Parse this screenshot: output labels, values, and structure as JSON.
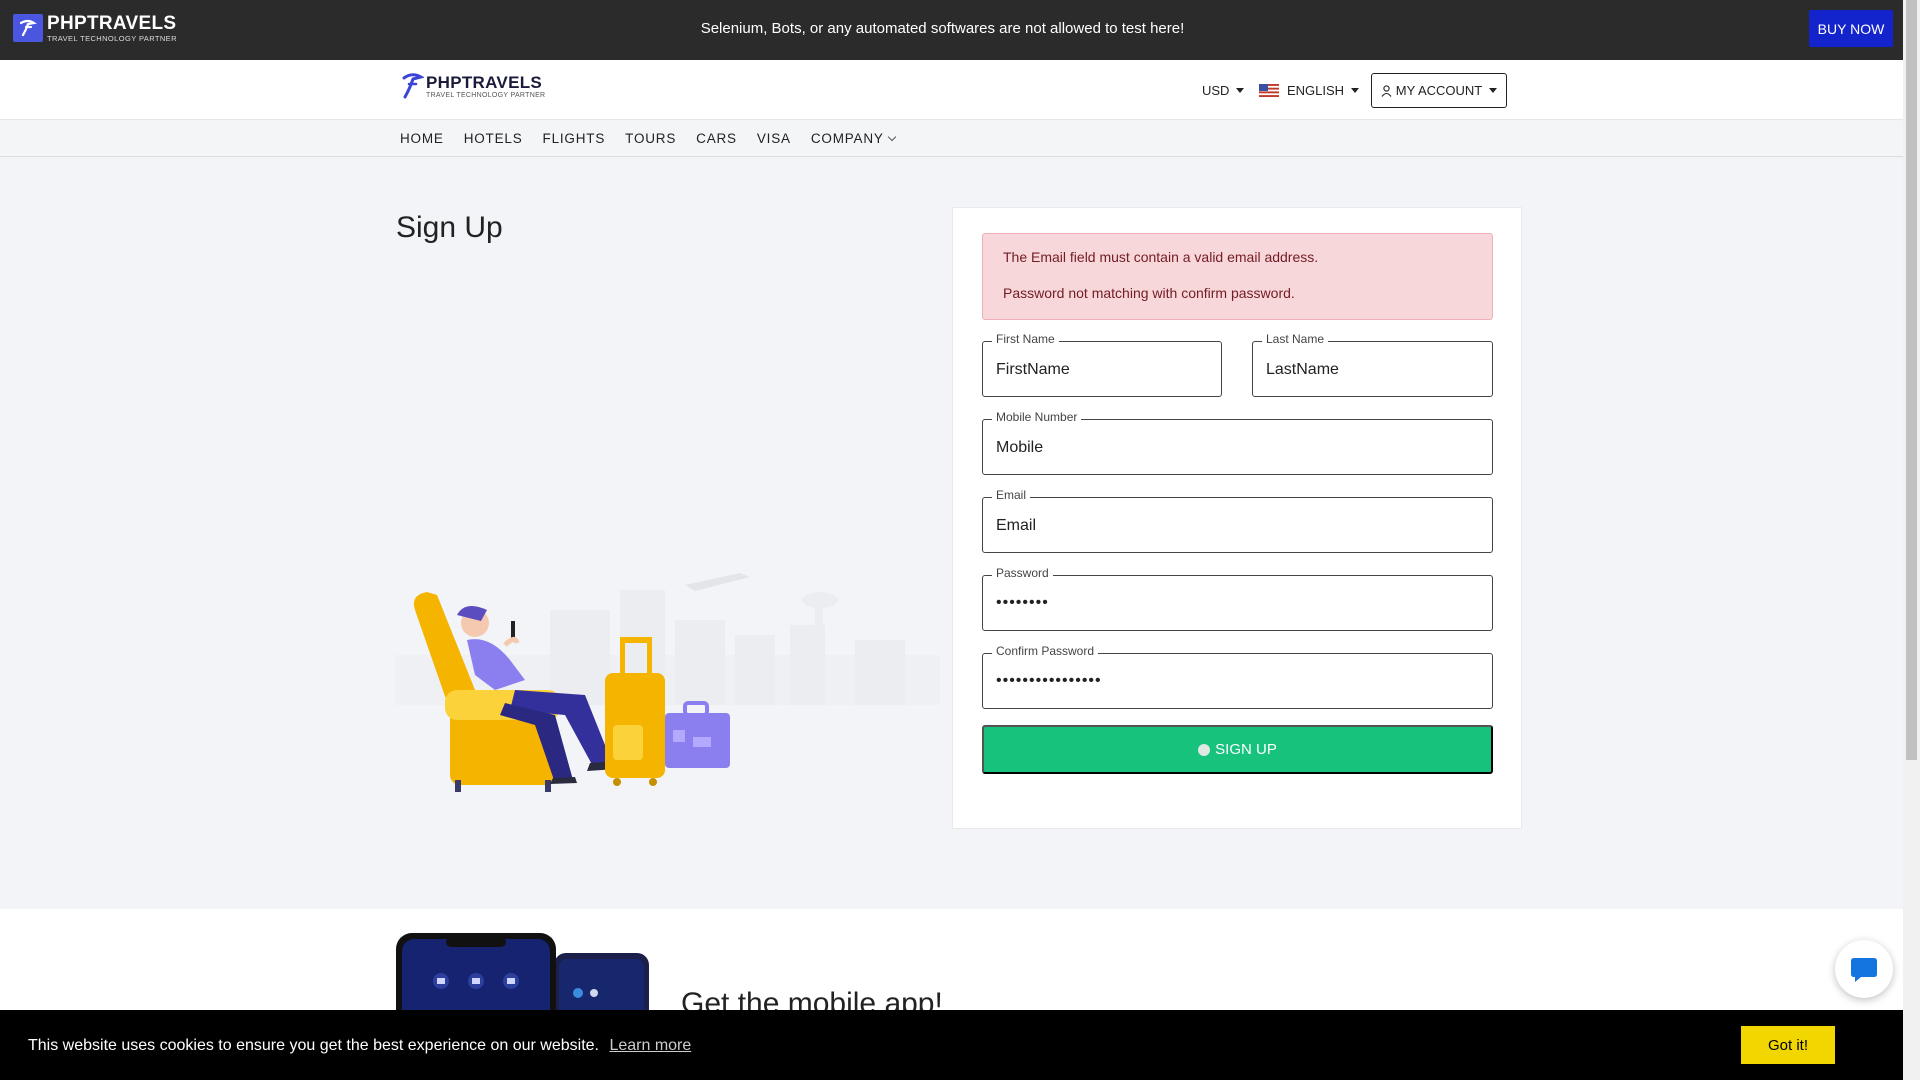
{
  "topbar": {
    "brand_name": "PHPTRAVELS",
    "brand_tagline": "TRAVEL TECHNOLOGY PARTNER",
    "notice": "Selenium, Bots, or any automated softwares are not allowed to test here!",
    "buy_now": "BUY NOW"
  },
  "header": {
    "logo_name": "PHPTRAVELS",
    "logo_tagline": "TRAVEL TECHNOLOGY PARTNER",
    "currency": "USD",
    "language": "ENGLISH",
    "account": "MY ACCOUNT"
  },
  "nav": {
    "items": [
      "HOME",
      "HOTELS",
      "FLIGHTS",
      "TOURS",
      "CARS",
      "VISA",
      "COMPANY"
    ]
  },
  "page": {
    "title": "Sign Up"
  },
  "form": {
    "errors": [
      "The Email field must contain a valid email address.",
      "Password not matching with confirm password."
    ],
    "first_name": {
      "label": "First Name",
      "value": "FirstName"
    },
    "last_name": {
      "label": "Last Name",
      "value": "LastName"
    },
    "mobile": {
      "label": "Mobile Number",
      "value": "Mobile"
    },
    "email": {
      "label": "Email",
      "value": "Email"
    },
    "password": {
      "label": "Password",
      "value": "••••••••"
    },
    "confirm_password": {
      "label": "Confirm Password",
      "value": "••••••••••••••••"
    },
    "submit": "SIGN UP"
  },
  "mobile_app": {
    "title": "Get the mobile app!"
  },
  "cookie": {
    "message": "This website uses cookies to ensure you get the best experience on our website.",
    "learn_more": "Learn more",
    "accept": "Got it!"
  },
  "colors": {
    "buy_now": "#1424cc",
    "signup_button": "#17c27d",
    "alert_bg": "#f8d7da",
    "cookie_button": "#f1d600"
  }
}
